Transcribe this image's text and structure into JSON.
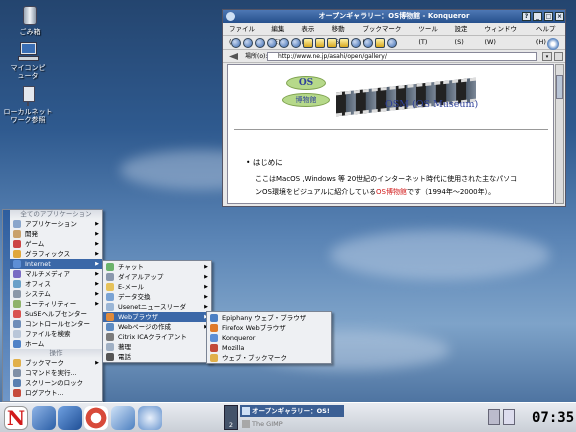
{
  "desktop_icons": [
    {
      "label": "ごみ箱"
    },
    {
      "label": "マイコンピュータ"
    },
    {
      "label": "ローカルネットワーク参照"
    }
  ],
  "konqueror": {
    "title": "オープンギャラリー：OS博物館 - Konqueror",
    "menu": [
      "ファイル(F)",
      "編集(E)",
      "表示(V)",
      "移動(G)",
      "ブックマーク(B)",
      "ツール(T)",
      "設定(S)",
      "ウィンドウ(W)",
      "ヘルプ(H)"
    ],
    "location_label": "場所(o):",
    "url": "http://www.ne.jp/asahi/open/gallery/",
    "logo_top": "OS",
    "logo_bottom": "博物館",
    "banner": "OSM (OS Museum)",
    "bullet": "はじめに",
    "para1": "ここはMacOS ,Windows 等 20世紀のインターネット時代に使用された主なパソコ",
    "para2_a": "ンOS環境をビジュアルに紹介している",
    "para2_link": "OS博物館",
    "para2_b": "です（1994年〜2000年）。"
  },
  "menu1": {
    "header": "全てのアプリケーション",
    "items": [
      "アプリケーション",
      "開発",
      "ゲーム",
      "グラフィックス",
      "Internet",
      "マルチメディア",
      "オフィス",
      "システム",
      "ユーティリティー",
      "SuSEヘルプセンター",
      "コントロールセンター",
      "ファイルを検索",
      "ホーム"
    ],
    "header2": "操作",
    "items2": [
      "ブックマーク",
      "コマンドを実行...",
      "スクリーンのロック",
      "ログアウト..."
    ]
  },
  "menu2": {
    "items": [
      "チャット",
      "ダイアルアップ",
      "E-メール",
      "データ交換",
      "Usenetニュースリーダ",
      "Webブラウザ",
      "Webページの作成",
      "Citrix ICAクライアント",
      "著理",
      "電話"
    ]
  },
  "menu3": {
    "items": [
      "Epiphany ウェブ・ブラウザ",
      "Firefox Webブラウザ",
      "Konqueror",
      "Mozilla",
      "ウェブ・ブックマーク"
    ]
  },
  "taskbar": {
    "pager": "2",
    "tasks": [
      "オープンギャラリー：OS!",
      "The GIMP"
    ],
    "clock": "07:35"
  },
  "colors": {
    "selection": "#3b68a8",
    "link": "#d21a1a",
    "banner": "#2d3f9a"
  }
}
